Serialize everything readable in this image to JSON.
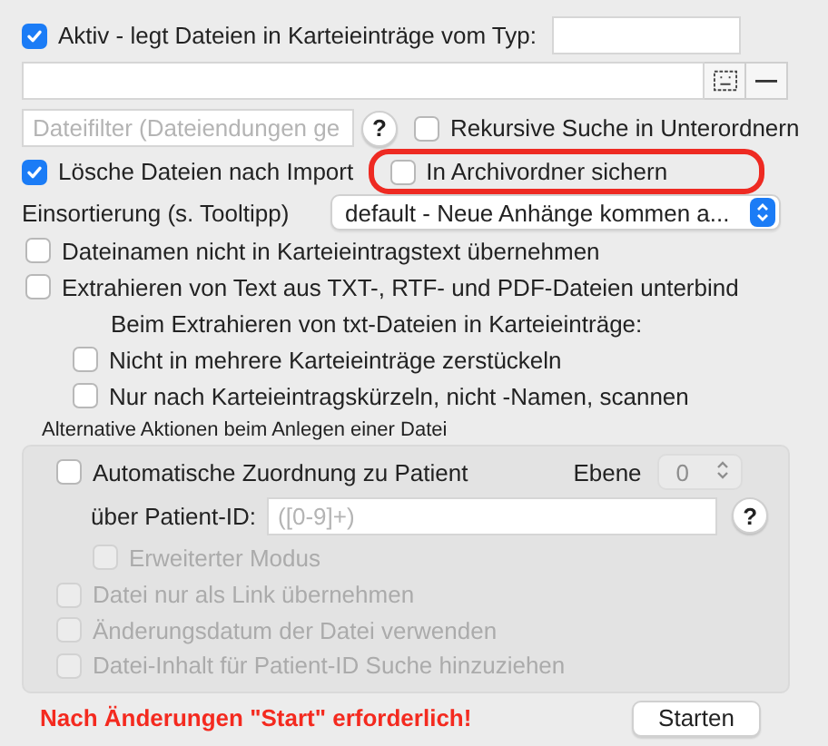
{
  "active": {
    "label": "Aktiv - legt Dateien in Karteieinträge vom Typ:",
    "checked": true
  },
  "filter_field": {
    "placeholder": "Dateifilter (Dateiendungen ge"
  },
  "filter_help": "?",
  "recursive": {
    "label": "Rekursive Suche in Unterordnern",
    "checked": false
  },
  "delete_after_import": {
    "label": "Lösche Dateien nach Import",
    "checked": true
  },
  "archive": {
    "label": "In Archivordner sichern",
    "checked": false,
    "highlighted": true
  },
  "sorting": {
    "label": "Einsortierung (s. Tooltipp)",
    "value": "default - Neue Anhänge kommen a..."
  },
  "options": [
    {
      "label": "Dateinamen nicht in Karteieintragstext übernehmen",
      "checked": false
    },
    {
      "label": "Extrahieren von Text aus TXT-, RTF- und PDF-Dateien unterbind",
      "checked": false
    }
  ],
  "txt_heading": "Beim Extrahieren von txt-Dateien in Karteieinträge:",
  "txt_options": [
    {
      "label": "Nicht in mehrere Karteieinträge zerstückeln",
      "checked": false
    },
    {
      "label": "Nur nach Karteieintragskürzeln, nicht -Namen, scannen",
      "checked": false
    }
  ],
  "alternative": {
    "title": "Alternative Aktionen beim Anlegen einer Datei",
    "auto_assign": {
      "label": "Automatische Zuordnung zu Patient",
      "checked": false
    },
    "level": {
      "label": "Ebene",
      "value": "0",
      "disabled": true
    },
    "patient_id": {
      "label": "über Patient-ID:",
      "placeholder": "([0-9]+)",
      "help": "?"
    },
    "extended": {
      "label": "Erweiterter Modus",
      "checked": false,
      "disabled": true
    },
    "options": [
      {
        "label": "Datei nur als Link übernehmen",
        "checked": false,
        "disabled": true
      },
      {
        "label": "Änderungsdatum der Datei verwenden",
        "checked": false,
        "disabled": true
      },
      {
        "label": "Datei-Inhalt für Patient-ID Suche hinzuziehen",
        "checked": false,
        "disabled": true
      }
    ]
  },
  "warning": "Nach Änderungen \"Start\" erforderlich!",
  "start_button": "Starten"
}
